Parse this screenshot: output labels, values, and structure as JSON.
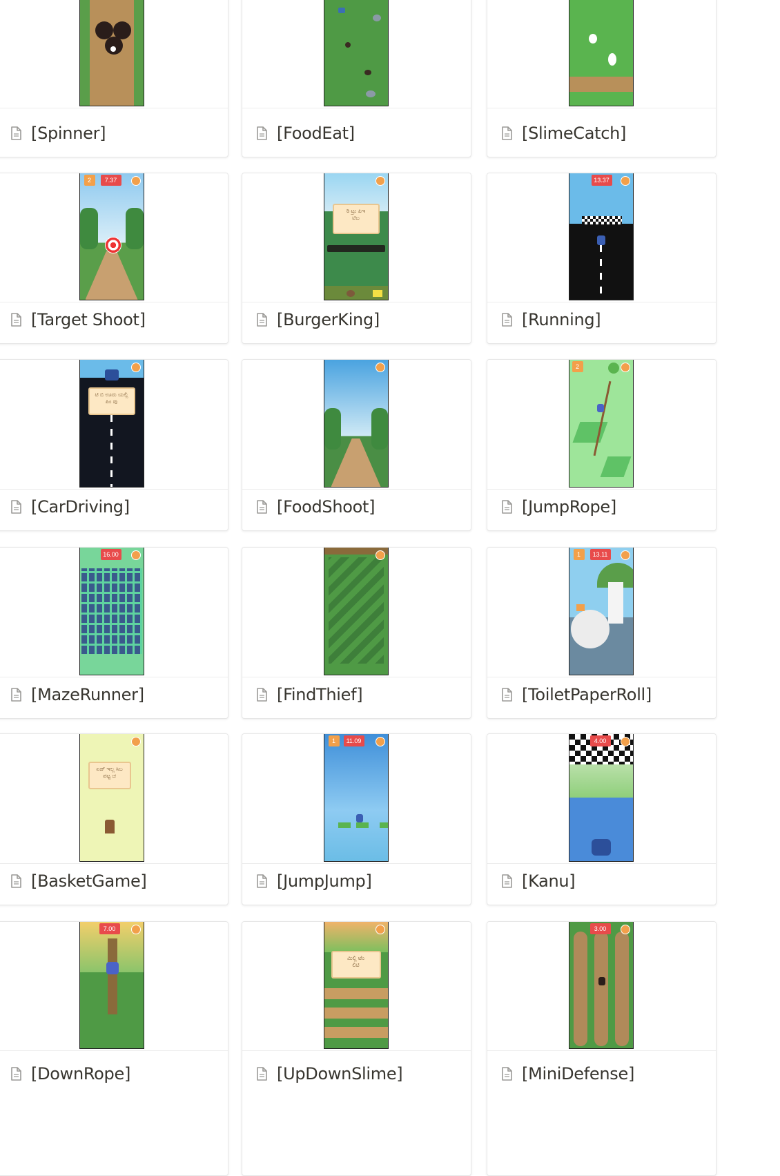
{
  "gallery": {
    "items": [
      {
        "label": "[Spinner]",
        "thumb": "spinner-thumbnail"
      },
      {
        "label": "[FoodEat]",
        "thumb": "foodeat-thumbnail"
      },
      {
        "label": "[SlimeCatch]",
        "thumb": "slimecatch-thumbnail"
      },
      {
        "label": "[Target Shoot]",
        "thumb": "targetshoot-thumbnail",
        "hud": {
          "score": "2",
          "timer": "7.37"
        }
      },
      {
        "label": "[BurgerKing]",
        "thumb": "burgerking-thumbnail"
      },
      {
        "label": "[Running]",
        "thumb": "running-thumbnail",
        "hud": {
          "timer": "13.37"
        }
      },
      {
        "label": "[CarDriving]",
        "thumb": "cardriving-thumbnail"
      },
      {
        "label": "[FoodShoot]",
        "thumb": "foodshoot-thumbnail"
      },
      {
        "label": "[JumpRope]",
        "thumb": "jumprope-thumbnail",
        "hud": {
          "score": "2"
        }
      },
      {
        "label": "[MazeRunner]",
        "thumb": "mazerunner-thumbnail",
        "hud": {
          "timer": "16.00"
        }
      },
      {
        "label": "[FindThief]",
        "thumb": "findthief-thumbnail"
      },
      {
        "label": "[ToiletPaperRoll]",
        "thumb": "toiletpaperroll-thumbnail",
        "hud": {
          "score": "1",
          "timer": "13.11"
        }
      },
      {
        "label": "[BasketGame]",
        "thumb": "basketgame-thumbnail"
      },
      {
        "label": "[JumpJump]",
        "thumb": "jumpjump-thumbnail",
        "hud": {
          "score": "1",
          "timer": "11.09"
        }
      },
      {
        "label": "[Kanu]",
        "thumb": "kanu-thumbnail",
        "hud": {
          "timer": "4.00"
        }
      },
      {
        "label": "[DownRope]",
        "thumb": "downrope-thumbnail",
        "hud": {
          "timer": "7.00"
        }
      },
      {
        "label": "[UpDownSlime]",
        "thumb": "updownslime-thumbnail"
      },
      {
        "label": "[MiniDefense]",
        "thumb": "minidefense-thumbnail",
        "hud": {
          "timer": "3.00"
        }
      }
    ]
  },
  "colors": {
    "grass": "#5a9e4a",
    "dirt": "#b8905a",
    "sky": "#8ec9ef",
    "road": "#1b1f2a",
    "maze_wall": "#3a5a8c",
    "maze_path": "#78d69a",
    "basket_bg": "#eef5b6",
    "text": "#37352f",
    "icon": "#9b9a97"
  },
  "icons": {
    "page": "document-icon"
  }
}
